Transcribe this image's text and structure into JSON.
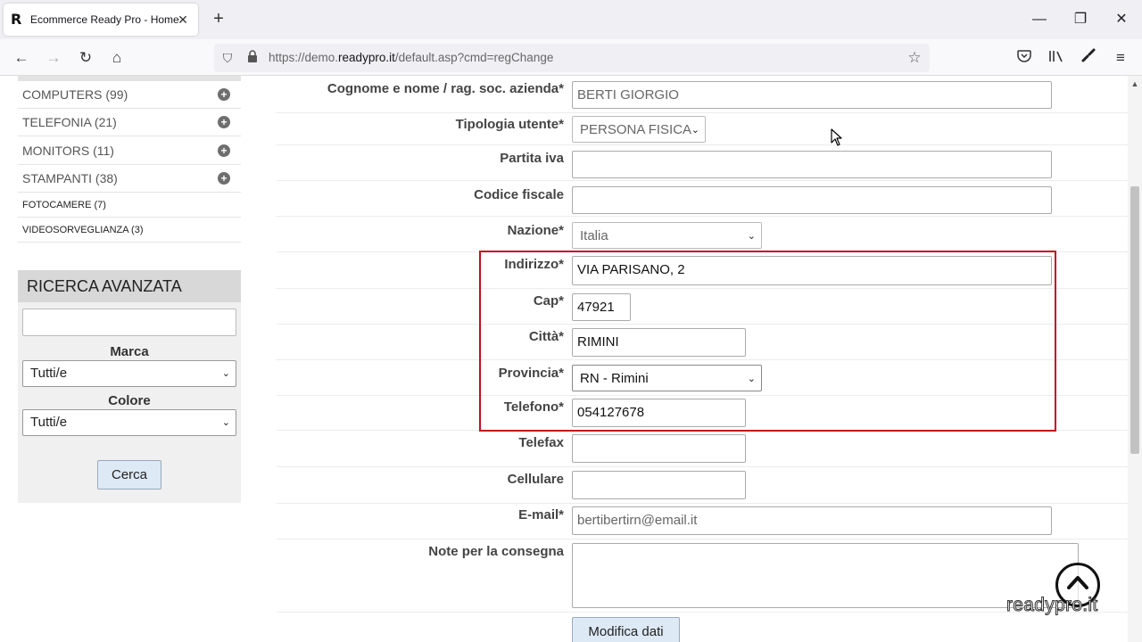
{
  "browser": {
    "tab_title": "Ecommerce Ready Pro - Home",
    "favicon_letter": "R",
    "url_prefix": "https://demo.",
    "url_host": "readypro.it",
    "url_path": "/default.asp?cmd=regChange"
  },
  "sidebar": {
    "categories": [
      {
        "label": "COMPUTERS (99)",
        "expandable": true
      },
      {
        "label": "TELEFONIA (21)",
        "expandable": true
      },
      {
        "label": "MONITORS (11)",
        "expandable": true
      },
      {
        "label": "STAMPANTI (38)",
        "expandable": true
      },
      {
        "label": "FOTOCAMERE (7)",
        "expandable": false
      },
      {
        "label": "VIDEOSORVEGLIANZA (3)",
        "expandable": false
      }
    ],
    "search": {
      "title": "RICERCA AVANZATA",
      "keyword_value": "",
      "marca_label": "Marca",
      "marca_value": "Tutti/e",
      "colore_label": "Colore",
      "colore_value": "Tutti/e",
      "button_label": "Cerca"
    }
  },
  "form": {
    "nome_label": "Cognome e nome / rag. soc. azienda*",
    "nome_value": "BERTI GIORGIO",
    "tipologia_label": "Tipologia utente*",
    "tipologia_value": "PERSONA FISICA",
    "piva_label": "Partita iva",
    "piva_value": "",
    "cf_label": "Codice fiscale",
    "cf_value": "",
    "nazione_label": "Nazione*",
    "nazione_value": "Italia",
    "indirizzo_label": "Indirizzo*",
    "indirizzo_value": "VIA PARISANO, 2",
    "cap_label": "Cap*",
    "cap_value": "47921",
    "citta_label": "Città*",
    "citta_value": "RIMINI",
    "provincia_label": "Provincia*",
    "provincia_value": "RN - Rimini",
    "telefono_label": "Telefono*",
    "telefono_value": "054127678",
    "telefax_label": "Telefax",
    "telefax_value": "",
    "cellulare_label": "Cellulare",
    "cellulare_value": "",
    "email_label": "E-mail*",
    "email_value": "bertibertirn@email.it",
    "note_label": "Note per la consegna",
    "note_value": "",
    "submit_label": "Modifica dati"
  },
  "watermark": "readypro.it",
  "colors": {
    "highlight_border": "#c0111f",
    "button_bg": "#dde9f5"
  }
}
